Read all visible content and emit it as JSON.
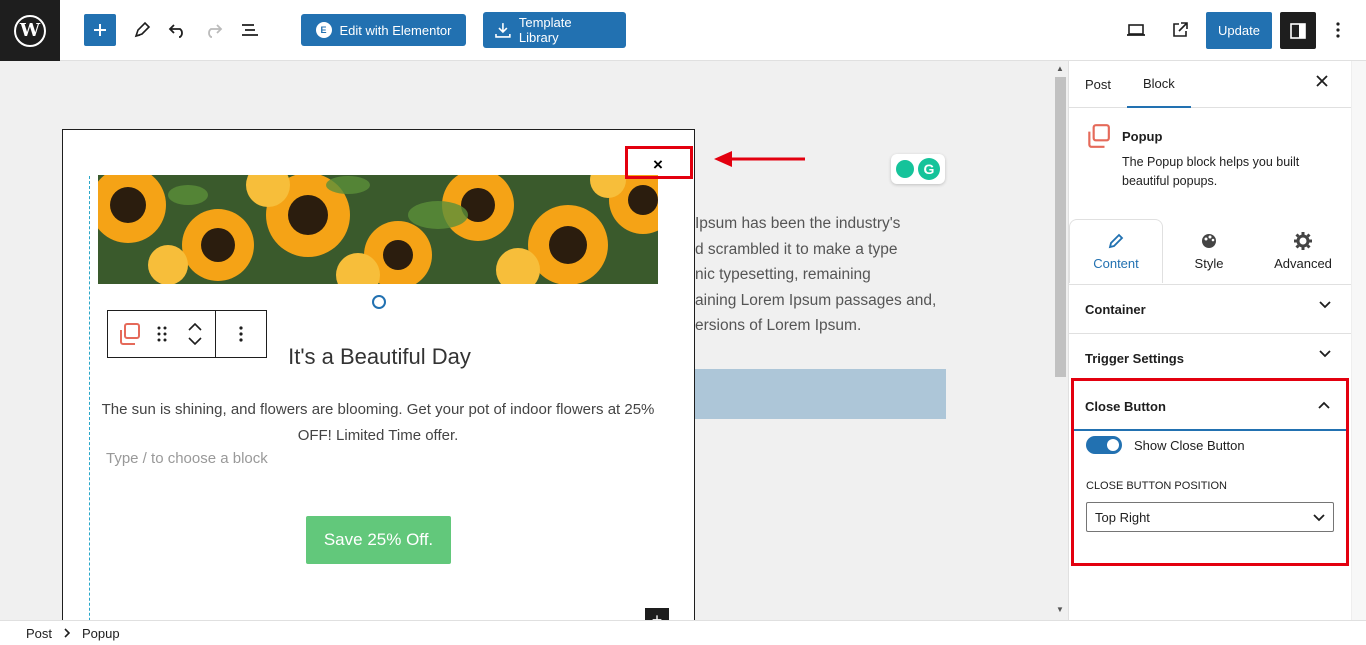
{
  "toolbar": {
    "wp_logo": "W",
    "edit_elementor": "Edit with Elementor",
    "template_library": "Template Library",
    "update": "Update"
  },
  "canvas": {
    "background_lines": [
      "Ipsum has been the industry's",
      "d scrambled it to make a type",
      "nic typesetting, remaining",
      "aining Lorem Ipsum passages and,",
      "ersions of Lorem Ipsum."
    ],
    "grammarly_letter": "G",
    "popup": {
      "close_glyph": "×",
      "heading": "It's a Beautiful Day",
      "description": "The sun is shining, and flowers are blooming. Get your pot of indoor flowers at 25% OFF! Limited Time offer.",
      "placeholder": "Type / to choose a block",
      "cta_label": "Save 25% Off.",
      "inserter_glyph": "+"
    }
  },
  "sidebar": {
    "tabs": [
      "Post",
      "Block"
    ],
    "block_card": {
      "title": "Popup",
      "description": "The Popup block helps you built beautiful popups."
    },
    "style_tabs": [
      "Content",
      "Style",
      "Advanced"
    ],
    "panels": [
      "Container",
      "Trigger Settings",
      "Close Button"
    ],
    "close_button": {
      "toggle_label": "Show Close Button",
      "toggle_on": true,
      "position_label": "Close Button Position",
      "position_value": "Top Right"
    }
  },
  "breadcrumb": [
    "Post",
    "Popup"
  ],
  "colors": {
    "accent": "#2271b1",
    "highlight": "#e3000f",
    "cta": "#62c87b"
  }
}
